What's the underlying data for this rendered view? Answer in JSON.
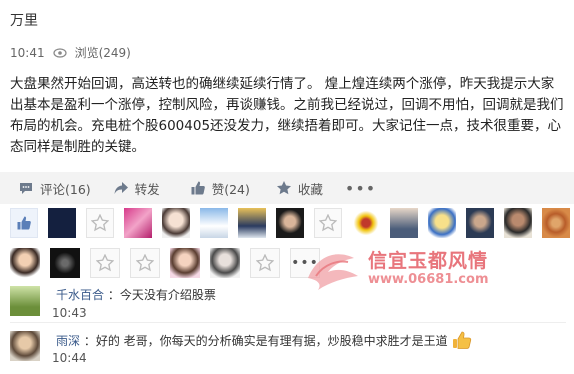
{
  "post": {
    "author": "万里",
    "time": "10:41",
    "views_label": "浏览(249)",
    "content": "大盘果然开始回调，高送转也的确继续延续行情了。 煌上煌连续两个涨停，昨天我提示大家出基本是盈利一个涨停，控制风险，再谈赚钱。之前我已经说过，回调不用怕，回调就是我们布局的机会。充电桩个股600405还没发力，继续捂着即可。大家记住一点，技术很重要，心态同样是制胜的关键。"
  },
  "actions": {
    "comment_label": "评论(16)",
    "share_label": "转发",
    "like_label": "赞(24)",
    "collect_label": "收藏",
    "more_label": "•••"
  },
  "likers": {
    "more_label": "•••"
  },
  "comments": [
    {
      "user": "千水百合",
      "text": "：今天没有介绍股票",
      "time": "10:43"
    },
    {
      "user": "雨深",
      "text": "：好的 老哥，你每天的分析确实是有理有据，炒股稳中求胜才是王道",
      "time": "10:44"
    }
  ],
  "watermark": {
    "title": "信宜玉都风情",
    "url": "www.06681.com"
  },
  "colors": {
    "action_bar_bg": "#f3f3f3",
    "link_blue": "#3a5a8a",
    "watermark_red": "#e8757c"
  }
}
